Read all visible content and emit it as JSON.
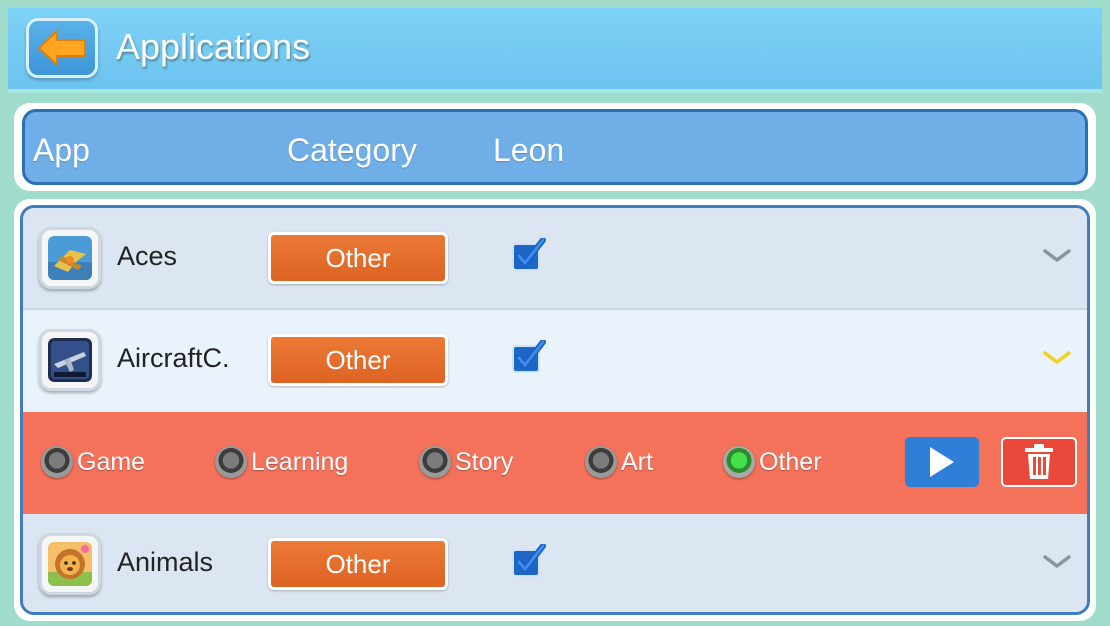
{
  "header": {
    "title": "Applications",
    "back_icon": "arrow-left-icon"
  },
  "columns": {
    "app": "App",
    "category": "Category",
    "user": "Leon"
  },
  "apps": [
    {
      "name": "Aces",
      "category": "Other",
      "enabled": true,
      "expanded": false,
      "icon": "aces-app-icon"
    },
    {
      "name": "AircraftC.",
      "category": "Other",
      "enabled": true,
      "expanded": true,
      "icon": "aircraft-app-icon"
    },
    {
      "name": "Animals",
      "category": "Other",
      "enabled": true,
      "expanded": false,
      "icon": "animals-app-icon"
    }
  ],
  "category_options": [
    {
      "label": "Game",
      "selected": false
    },
    {
      "label": "Learning",
      "selected": false
    },
    {
      "label": "Story",
      "selected": false
    },
    {
      "label": "Art",
      "selected": false
    },
    {
      "label": "Other",
      "selected": true
    }
  ],
  "actions": {
    "play_icon": "play-icon",
    "delete_icon": "trash-icon"
  },
  "colors": {
    "titlebar": "#7fd2f7",
    "header_panel": "#6faee6",
    "category_button": "#e46d2c",
    "expanded_row": "#f4715a",
    "play_button": "#2f7fd8",
    "delete_button": "#e8493a"
  }
}
